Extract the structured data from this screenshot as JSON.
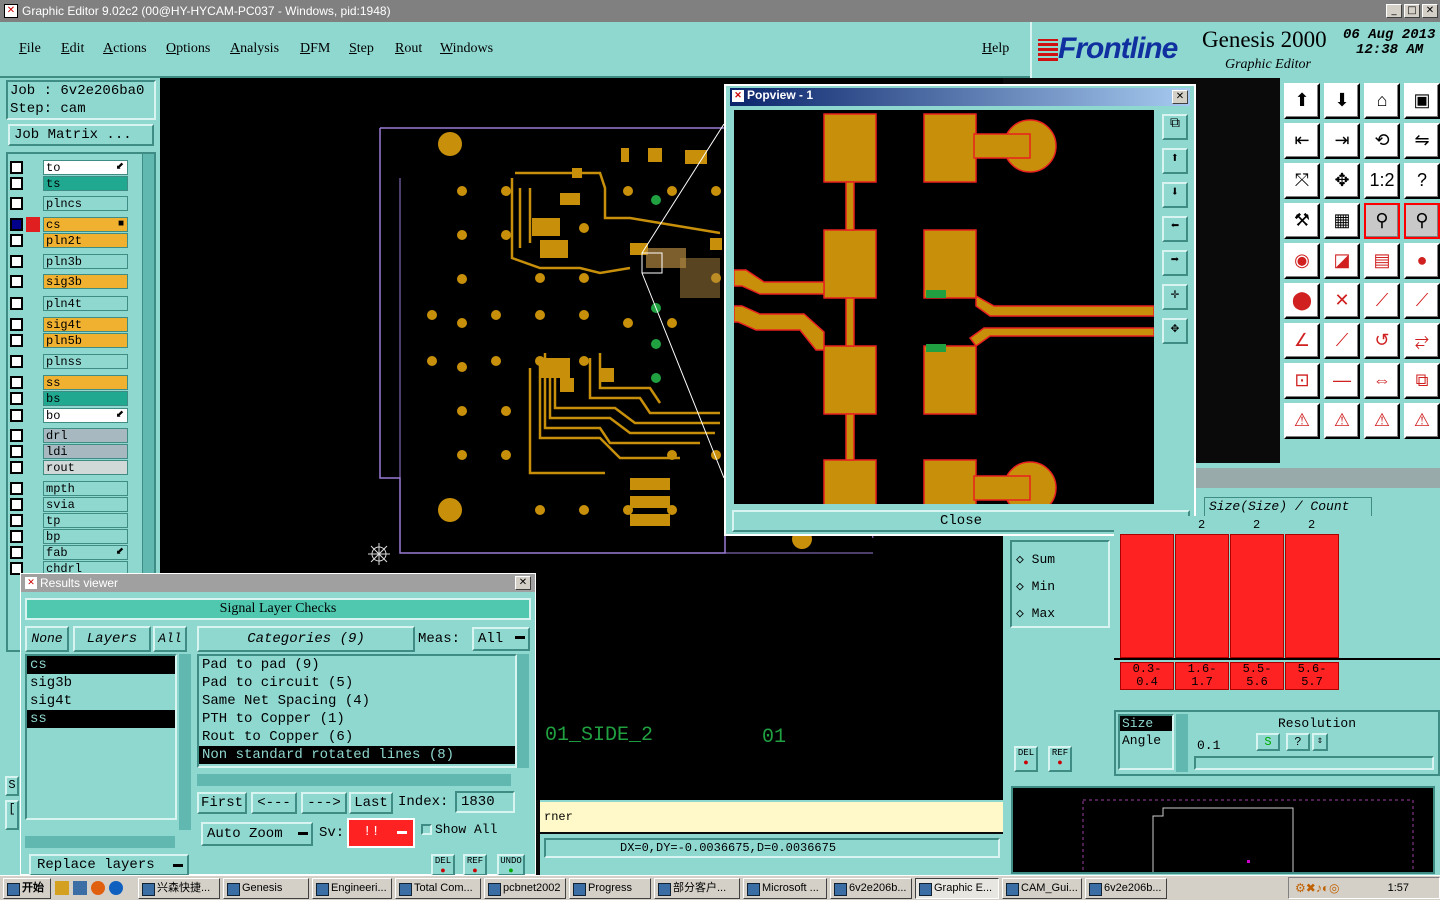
{
  "window": {
    "title": "Graphic Editor 9.02c2 (00@HY-HYCAM-PC037 - Windows, pid:1948)",
    "min": "_",
    "max": "□",
    "close": "✕"
  },
  "menu": [
    "File",
    "Edit",
    "Actions",
    "Options",
    "Analysis",
    "DFM",
    "Step",
    "Rout",
    "Windows"
  ],
  "help": "Help",
  "brand": {
    "logo": "Frontline",
    "product": "Genesis 2000",
    "subtitle": "Graphic Editor",
    "date": "06 Aug 2013",
    "time": "12:38 AM"
  },
  "job": {
    "job_label": "Job : 6v2e206ba0",
    "step_label": "Step: cam",
    "matrix_button": "Job Matrix ..."
  },
  "layers": [
    {
      "name": "to",
      "color": "#ffffff",
      "mark": "⬋"
    },
    {
      "name": "ts",
      "color": "#20a890",
      "mark": ""
    },
    {
      "name": "plncs",
      "color": "#8fd8d0",
      "mark": ""
    },
    {
      "name": "cs",
      "color": "#f0b030",
      "mark": "■"
    },
    {
      "name": "pln2t",
      "color": "#f0b030",
      "mark": ""
    },
    {
      "name": "pln3b",
      "color": "#8fd8d0",
      "mark": ""
    },
    {
      "name": "sig3b",
      "color": "#f0b030",
      "mark": ""
    },
    {
      "name": "pln4t",
      "color": "#8fd8d0",
      "mark": ""
    },
    {
      "name": "sig4t",
      "color": "#f0b030",
      "mark": ""
    },
    {
      "name": "pln5b",
      "color": "#f0b030",
      "mark": ""
    },
    {
      "name": "plnss",
      "color": "#8fd8d0",
      "mark": ""
    },
    {
      "name": "ss",
      "color": "#f0b030",
      "mark": ""
    },
    {
      "name": "bs",
      "color": "#20a890",
      "mark": ""
    },
    {
      "name": "bo",
      "color": "#ffffff",
      "mark": "⬋"
    },
    {
      "name": "drl",
      "color": "#a8b8c0",
      "mark": ""
    },
    {
      "name": "ldi",
      "color": "#a8b8c0",
      "mark": ""
    },
    {
      "name": "rout",
      "color": "#d0d8d8",
      "mark": ""
    },
    {
      "name": "mpth",
      "color": "#8fd8d0",
      "mark": ""
    },
    {
      "name": "svia",
      "color": "#8fd8d0",
      "mark": ""
    },
    {
      "name": "tp",
      "color": "#8fd8d0",
      "mark": ""
    },
    {
      "name": "bp",
      "color": "#8fd8d0",
      "mark": ""
    },
    {
      "name": "fab",
      "color": "#8fd8d0",
      "mark": "⬋"
    },
    {
      "name": "chdrl",
      "color": "#8fd8d0",
      "mark": ""
    }
  ],
  "popview": {
    "title": "Popview - 1",
    "close_label": "Close"
  },
  "results": {
    "title": "Results viewer",
    "header": "Signal Layer Checks",
    "none_btn": "None",
    "layers_btn": "Layers",
    "all_btn": "All",
    "categories_btn": "Categories (9)",
    "meas_label": "Meas:",
    "meas_value": "All",
    "layers": [
      "cs",
      "sig3b",
      "sig4t",
      "ss"
    ],
    "categories": [
      "Pad to pad (9)",
      "Pad to circuit (5)",
      "Same Net Spacing (4)",
      "PTH to Copper (1)",
      "Rout to Copper (6)",
      "Non standard rotated lines (8)"
    ],
    "first": "First",
    "prev": "<---",
    "next": "--->",
    "last": "Last",
    "index_label": "Index:",
    "index_value": "1830",
    "auto_zoom": "Auto Zoom",
    "sv_label": "Sv:",
    "sv_value": "!!",
    "show_all": "Show All",
    "replace_layers": "Replace layers",
    "del": "DEL",
    "ref": "REF",
    "undo": "UNDO"
  },
  "canvas_text": {
    "side_label": "01_SIDE_2",
    "num_label": "01",
    "corner": "rner",
    "measure": "DX=0,DY=-0.0036675,D=0.0036675"
  },
  "histogram": {
    "header": "Size(Size) / Count",
    "counts": [
      2,
      2,
      2
    ],
    "bins": [
      {
        "low": "0.3-",
        "high": "0.4"
      },
      {
        "low": "1.6-",
        "high": "1.7"
      },
      {
        "low": "5.5-",
        "high": "5.6"
      },
      {
        "low": "5.6-",
        "high": "5.7"
      }
    ],
    "stats": [
      "Sum",
      "Min",
      "Max"
    ],
    "axis_opts": [
      "Size",
      "Angle"
    ],
    "resolution_label": "Resolution",
    "resolution_value": "0.1",
    "del": "DEL",
    "ref": "REF"
  },
  "taskbar": {
    "start": "开始",
    "tasks": [
      "兴森快捷...",
      "Genesis",
      "Engineeri...",
      "Total Com...",
      "pcbnet2002",
      "Progress",
      "部分客户...",
      "Microsoft ...",
      "6v2e206b...",
      "Graphic E...",
      "CAM_Gui...",
      "6v2e206b..."
    ],
    "clock": "1:57"
  }
}
